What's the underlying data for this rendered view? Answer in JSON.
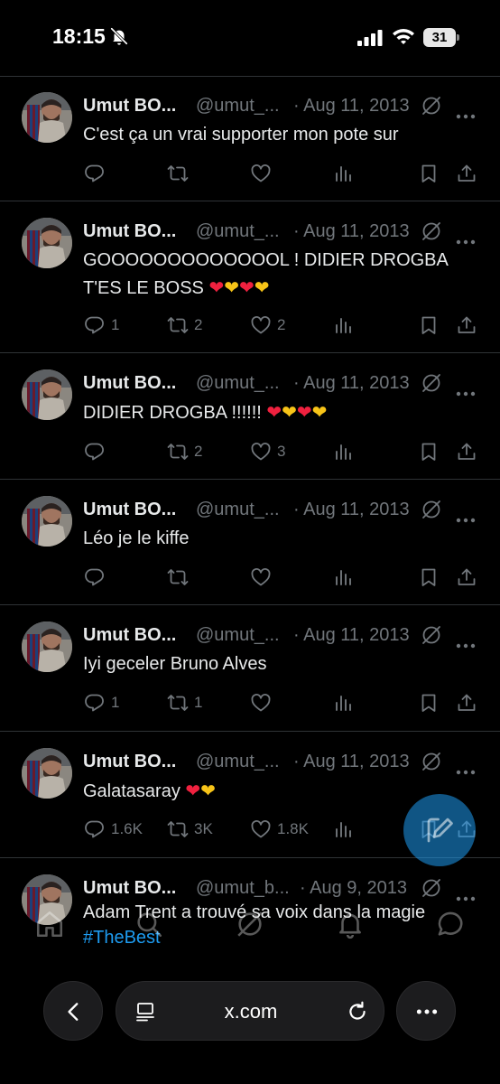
{
  "status_bar": {
    "time": "18:15",
    "battery": "31"
  },
  "profile": {
    "name": "Umut BO...",
    "handle": "@umut_...",
    "handle_alt": "@umut_b..."
  },
  "tweets": [
    {
      "date": "· Aug 11, 2013",
      "text": "C'est ça un vrai supporter mon pote sur",
      "reply_count": "",
      "retweet_count": "",
      "like_count": ""
    },
    {
      "date": "· Aug 11, 2013",
      "text_line1": "GOOOOOOOOOOOOOL ! DIDIER DROGBA",
      "text_line2": "T'ES LE BOSS",
      "reply_count": "1",
      "retweet_count": "2",
      "like_count": "2"
    },
    {
      "date": "· Aug 11, 2013",
      "text": "DIDIER DROGBA !!!!!!",
      "reply_count": "",
      "retweet_count": "2",
      "like_count": "3"
    },
    {
      "date": "· Aug 11, 2013",
      "text": "Léo je le kiffe",
      "reply_count": "",
      "retweet_count": "",
      "like_count": ""
    },
    {
      "date": "· Aug 11, 2013",
      "text": "Iyi geceler Bruno Alves",
      "reply_count": "1",
      "retweet_count": "1",
      "like_count": ""
    },
    {
      "date": "· Aug 11, 2013",
      "text": "Galatasaray",
      "reply_count": "1.6K",
      "retweet_count": "3K",
      "like_count": "1.8K"
    },
    {
      "date": "· Aug 9, 2013",
      "text": "Adam Trent a trouvé sa voix dans la magie",
      "hashtag": "#TheBest"
    }
  ],
  "browser": {
    "url": "x.com"
  },
  "colors": {
    "background": "#000000",
    "text": "#e7e9ea",
    "muted": "#71767b",
    "accent": "#1d9bf0",
    "divider": "#2f3336",
    "heart_red": "#f0213f",
    "heart_yellow": "#f7c418"
  },
  "icons": {
    "status": [
      "bell-off-icon",
      "signal-icon",
      "wifi-icon",
      "battery-icon"
    ],
    "tweet_actions": [
      "reply-icon",
      "retweet-icon",
      "like-icon",
      "views-icon",
      "bookmark-icon",
      "share-icon"
    ],
    "tabs": [
      "home-icon",
      "search-icon",
      "grok-icon",
      "notifications-icon",
      "messages-icon"
    ],
    "browser": [
      "back-icon",
      "reader-icon",
      "reload-icon",
      "more-icon"
    ],
    "fab": "compose-icon"
  }
}
